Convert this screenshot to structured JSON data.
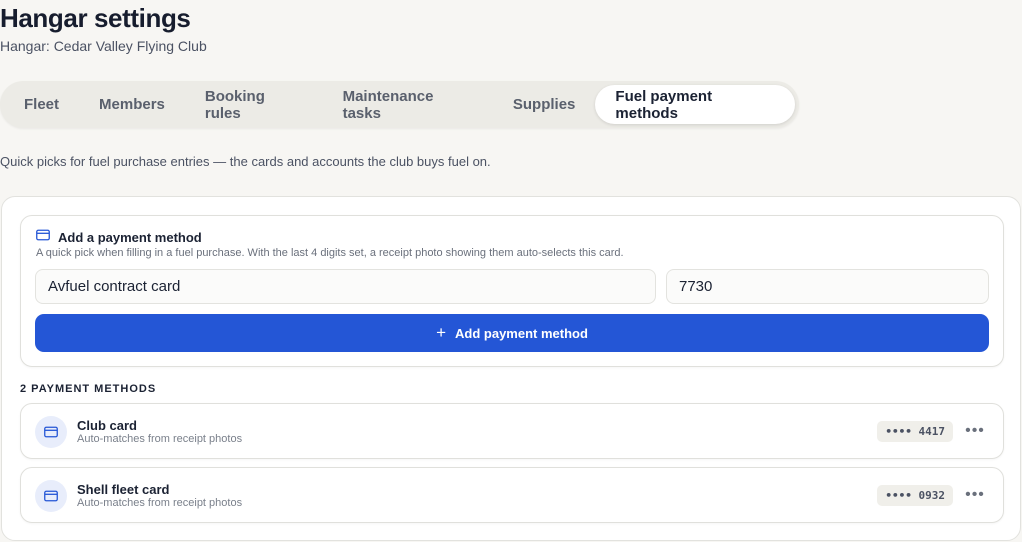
{
  "page": {
    "title": "Hangar settings",
    "subtitle": "Hangar: Cedar Valley Flying Club"
  },
  "tabs": [
    {
      "label": "Fleet",
      "active": false
    },
    {
      "label": "Members",
      "active": false
    },
    {
      "label": "Booking rules",
      "active": false
    },
    {
      "label": "Maintenance tasks",
      "active": false
    },
    {
      "label": "Supplies",
      "active": false
    },
    {
      "label": "Fuel payment methods",
      "active": true
    }
  ],
  "description": "Quick picks for fuel purchase entries — the cards and accounts the club buys fuel on.",
  "add_form": {
    "title": "Add a payment method",
    "hint": "A quick pick when filling in a fuel purchase. With the last 4 digits set, a receipt photo showing them auto-selects this card.",
    "name_value": "Avfuel contract card",
    "digits_value": "7730",
    "button_label": "Add payment method",
    "icon": "credit-card-icon"
  },
  "methods_count_label": "2 PAYMENT METHODS",
  "methods": [
    {
      "name": "Club card",
      "subtitle": "Auto-matches from receipt photos",
      "dots": "••••",
      "last4": "4417"
    },
    {
      "name": "Shell fleet card",
      "subtitle": "Auto-matches from receipt photos",
      "dots": "••••",
      "last4": "0932"
    }
  ],
  "colors": {
    "accent": "#2456d6",
    "background": "#f7f6f3",
    "icon_circle": "#e8edfb"
  }
}
